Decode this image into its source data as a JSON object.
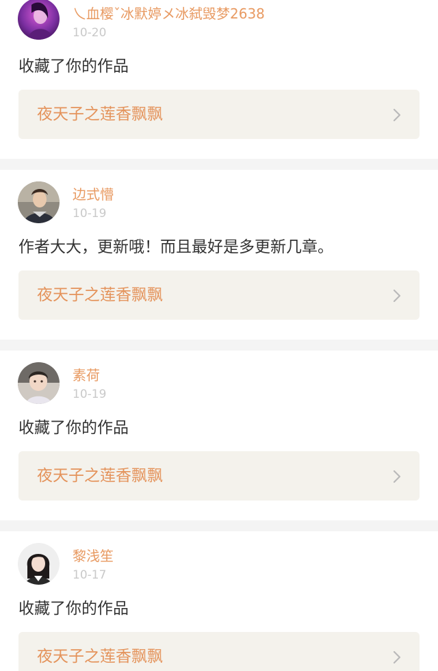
{
  "feed": {
    "items": [
      {
        "username": "乀血樱ˇ冰默婷メ冰弑毁梦2638",
        "date": "10-20",
        "message": "收藏了你的作品",
        "work_title": "夜天子之莲香飘飘",
        "avatar_icon": "user-avatar-purple"
      },
      {
        "username": "边式懵",
        "date": "10-19",
        "message": "作者大大，更新哦！而且最好是多更新几章。",
        "work_title": "夜天子之莲香飘飘",
        "avatar_icon": "user-avatar-man"
      },
      {
        "username": "素荷",
        "date": "10-19",
        "message": "收藏了你的作品",
        "work_title": "夜天子之莲香飘飘",
        "avatar_icon": "user-avatar-baby"
      },
      {
        "username": "黎浅笙",
        "date": "10-17",
        "message": "收藏了你的作品",
        "work_title": "夜天子之莲香飘飘",
        "avatar_icon": "user-avatar-girl"
      }
    ]
  },
  "colors": {
    "accent": "#e89a62",
    "separator": "#f4f4f4",
    "work_box": "#f4f2ec",
    "text": "#333333",
    "date": "#c9c9c9"
  }
}
